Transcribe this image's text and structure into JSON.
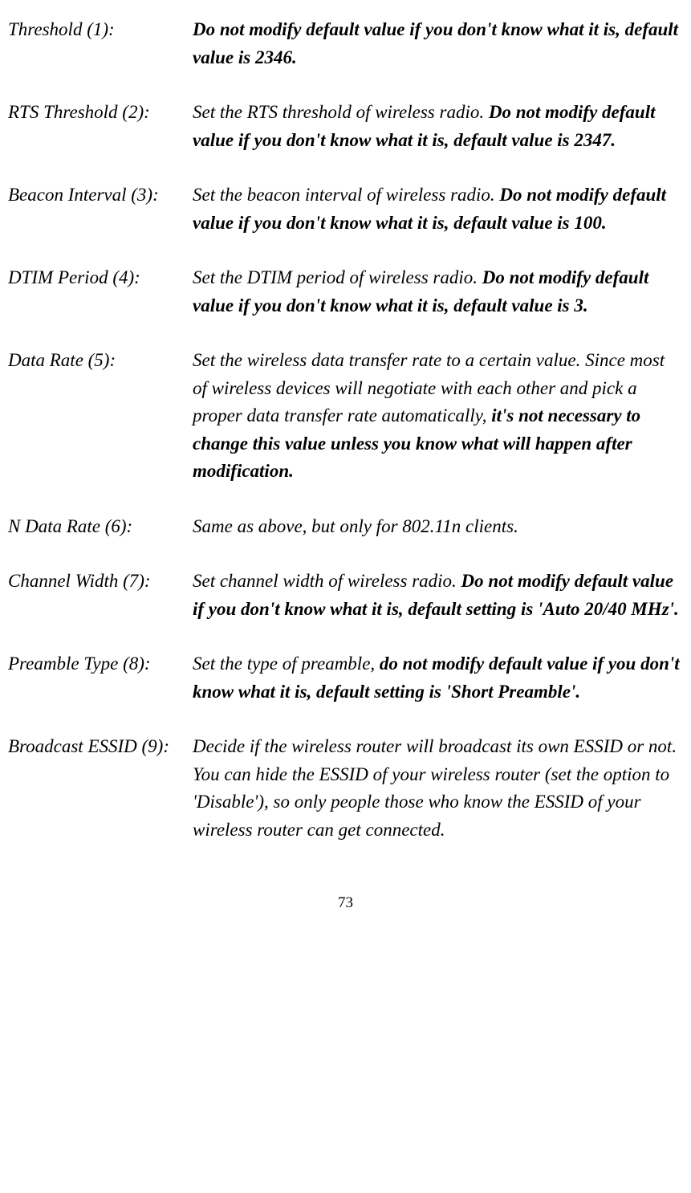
{
  "entries": [
    {
      "label": "Threshold (1):",
      "desc_normal_1": "",
      "desc_bold": "Do not modify default value if you don't know what it is, default value is 2346.",
      "desc_normal_2": ""
    },
    {
      "label": "RTS Threshold (2):",
      "desc_normal_1": "Set the RTS threshold of wireless radio. ",
      "desc_bold": "Do not modify default value if you don't know what it is, default value is 2347.",
      "desc_normal_2": ""
    },
    {
      "label": "Beacon Interval (3):",
      "desc_normal_1": "Set the beacon interval of wireless radio. ",
      "desc_bold": "Do not modify default value if you don't know what it is, default value is 100.",
      "desc_normal_2": ""
    },
    {
      "label": "DTIM Period (4):",
      "desc_normal_1": "Set the DTIM period of wireless radio. ",
      "desc_bold": "Do not modify default value if you don't know what it is, default value is 3.",
      "desc_normal_2": ""
    },
    {
      "label": "Data Rate (5):",
      "desc_normal_1": "Set the wireless data transfer rate to a certain value. Since most of wireless devices will negotiate with each other and pick a proper data transfer rate automatically, ",
      "desc_bold": "it's not necessary to change this value unless you know what will happen after modification.",
      "desc_normal_2": ""
    },
    {
      "label": "N Data Rate (6):",
      "desc_normal_1": "Same as above, but only for 802.11n clients.",
      "desc_bold": "",
      "desc_normal_2": ""
    },
    {
      "label": "Channel Width (7):",
      "desc_normal_1": "Set channel width of wireless radio. ",
      "desc_bold": "Do not modify default value if you don't know what it is, default setting is 'Auto 20/40 MHz'.",
      "desc_normal_2": ""
    },
    {
      "label": "Preamble Type (8):",
      "desc_normal_1": "Set the type of preamble, ",
      "desc_bold": "do not modify default value if you don't know what it is, default setting is 'Short Preamble'.",
      "desc_normal_2": ""
    },
    {
      "label": "Broadcast ESSID (9):",
      "desc_normal_1": "Decide if the wireless router will broadcast its own ESSID or not. You can hide the ESSID of your wireless router (set the option to 'Disable'), so only people those who know the ESSID of your wireless router can get connected.",
      "desc_bold": "",
      "desc_normal_2": ""
    }
  ],
  "page_number": "73"
}
